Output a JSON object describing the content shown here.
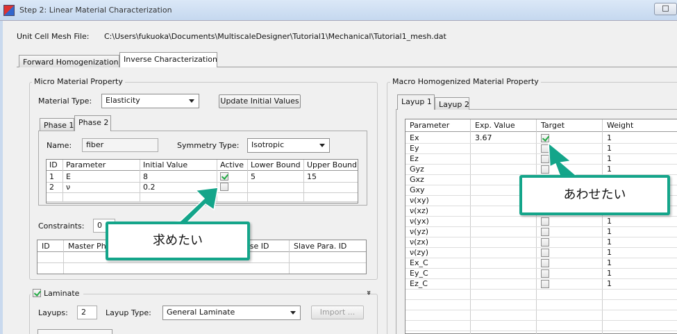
{
  "window": {
    "title": "Step 2: Linear Material Characterization",
    "button": "□"
  },
  "mesh": {
    "label": "Unit Cell Mesh File:",
    "path": "C:\\Users\\fukuoka\\Documents\\MultiscaleDesigner\\Tutorial1\\Mechanical\\Tutorial1_mesh.dat"
  },
  "main_tabs": [
    "Forward Homogenization",
    "Inverse Characterization"
  ],
  "micro": {
    "title": "Micro Material Property",
    "material_type_label": "Material Type:",
    "material_type": "Elasticity",
    "update_button": "Update Initial Values",
    "phase_tabs": [
      "Phase 1",
      "Phase 2"
    ],
    "name_label": "Name:",
    "name_value": "fiber",
    "symmetry_label": "Symmetry Type:",
    "symmetry_value": "Isotropic",
    "table": {
      "headers": [
        "ID",
        "Parameter",
        "Initial Value",
        "Active",
        "Lower Bound",
        "Upper Bound"
      ],
      "rows": [
        {
          "id": "1",
          "param": "E",
          "init": "8",
          "active": true,
          "lower": "5",
          "upper": "15"
        },
        {
          "id": "2",
          "param": "ν",
          "init": "0.2",
          "active": false,
          "lower": "",
          "upper": ""
        }
      ]
    },
    "constraints_label": "Constraints:",
    "constraints_value": "0",
    "constraints_headers": [
      "ID",
      "Master Pha",
      "ase ID",
      "Slave Para. ID"
    ]
  },
  "laminate": {
    "label": "Laminate",
    "checked": true,
    "layups_label": "Layups:",
    "layups_value": "2",
    "layup_type_label": "Layup Type:",
    "layup_type": "General Laminate",
    "import_button": "Import ...",
    "collapse_icon": "»"
  },
  "macro": {
    "title": "Macro Homogenized Material Property",
    "layup_tabs": [
      "Layup 1",
      "Layup 2"
    ],
    "headers": [
      "Parameter",
      "Exp. Value",
      "Target",
      "Weight"
    ],
    "rows": [
      {
        "param": "Ex",
        "exp": "3.67",
        "target": true,
        "weight": "1"
      },
      {
        "param": "Ey",
        "exp": "",
        "target": false,
        "weight": "1"
      },
      {
        "param": "Ez",
        "exp": "",
        "target": false,
        "weight": "1"
      },
      {
        "param": "Gyz",
        "exp": "",
        "target": false,
        "weight": "1"
      },
      {
        "param": "Gxz",
        "exp": "",
        "target": false,
        "weight": ""
      },
      {
        "param": "Gxy",
        "exp": "",
        "target": false,
        "weight": ""
      },
      {
        "param": "ν(xy)",
        "exp": "",
        "target": false,
        "weight": ""
      },
      {
        "param": "ν(xz)",
        "exp": "",
        "target": false,
        "weight": ""
      },
      {
        "param": "ν(yx)",
        "exp": "",
        "target": false,
        "weight": "1"
      },
      {
        "param": "ν(yz)",
        "exp": "",
        "target": false,
        "weight": "1"
      },
      {
        "param": "ν(zx)",
        "exp": "",
        "target": false,
        "weight": "1"
      },
      {
        "param": "ν(zy)",
        "exp": "",
        "target": false,
        "weight": "1"
      },
      {
        "param": "Ex_C",
        "exp": "",
        "target": false,
        "weight": "1"
      },
      {
        "param": "Ey_C",
        "exp": "",
        "target": false,
        "weight": "1"
      },
      {
        "param": "Ez_C",
        "exp": "",
        "target": false,
        "weight": "1"
      }
    ]
  },
  "callouts": {
    "left": "求めたい",
    "right": "あわせたい"
  },
  "colors": {
    "callout_border": "#14a58a"
  }
}
